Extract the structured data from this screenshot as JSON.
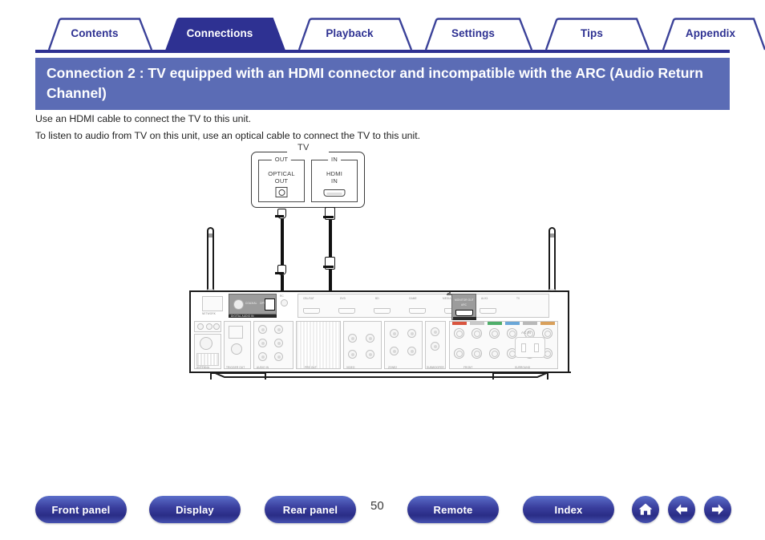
{
  "tabs": [
    {
      "label": "Contents",
      "active": false
    },
    {
      "label": "Connections",
      "active": true
    },
    {
      "label": "Playback",
      "active": false
    },
    {
      "label": "Settings",
      "active": false
    },
    {
      "label": "Tips",
      "active": false
    },
    {
      "label": "Appendix",
      "active": false
    }
  ],
  "header": {
    "title": "Connection 2 : TV equipped with an HDMI connector and incompatible with the ARC (Audio Return Channel)"
  },
  "body": {
    "line1": "Use an HDMI cable to connect the TV to this unit.",
    "line2": "To listen to audio from TV on this unit, use an optical cable to connect the TV to this unit."
  },
  "figure": {
    "tv_label": "TV",
    "optical_port": {
      "direction": "OUT",
      "name_line1": "OPTICAL",
      "name_line2": "OUT"
    },
    "hdmi_port": {
      "direction": "IN",
      "name_line1": "HDMI",
      "name_line2": "IN"
    },
    "receiver": {
      "digital_in_label": "DIGITAL AUDIO IN",
      "coaxial_label": "COAXIAL",
      "optical_label": "OPTICAL",
      "monitor_out_label_line1": "MONITOR OUT",
      "monitor_out_label_line2": "ARC",
      "hdmi_row_labels": [
        "CBL/SAT",
        "DVD",
        "BD",
        "GAME",
        "MEDIA PLAYER",
        "AUX1",
        "TV"
      ],
      "ac_in_label": "AC IN",
      "speaker_labels": [
        "FRONT",
        "CENTER",
        "SURROUND",
        "SURROUND BACK",
        "PRE OUT"
      ]
    }
  },
  "footer": {
    "buttons": [
      {
        "label": "Front panel"
      },
      {
        "label": "Display"
      },
      {
        "label": "Rear panel"
      },
      {
        "label": "Remote"
      },
      {
        "label": "Index"
      }
    ],
    "page_number": "50",
    "icons": [
      {
        "name": "home-icon",
        "glyph": "⌂"
      },
      {
        "name": "back-icon",
        "glyph": "←"
      },
      {
        "name": "forward-icon",
        "glyph": "→"
      }
    ]
  },
  "colors": {
    "tab_active": "#2e3192",
    "title_banner": "#5b6cb5",
    "button_blue": "#2a2d86"
  }
}
